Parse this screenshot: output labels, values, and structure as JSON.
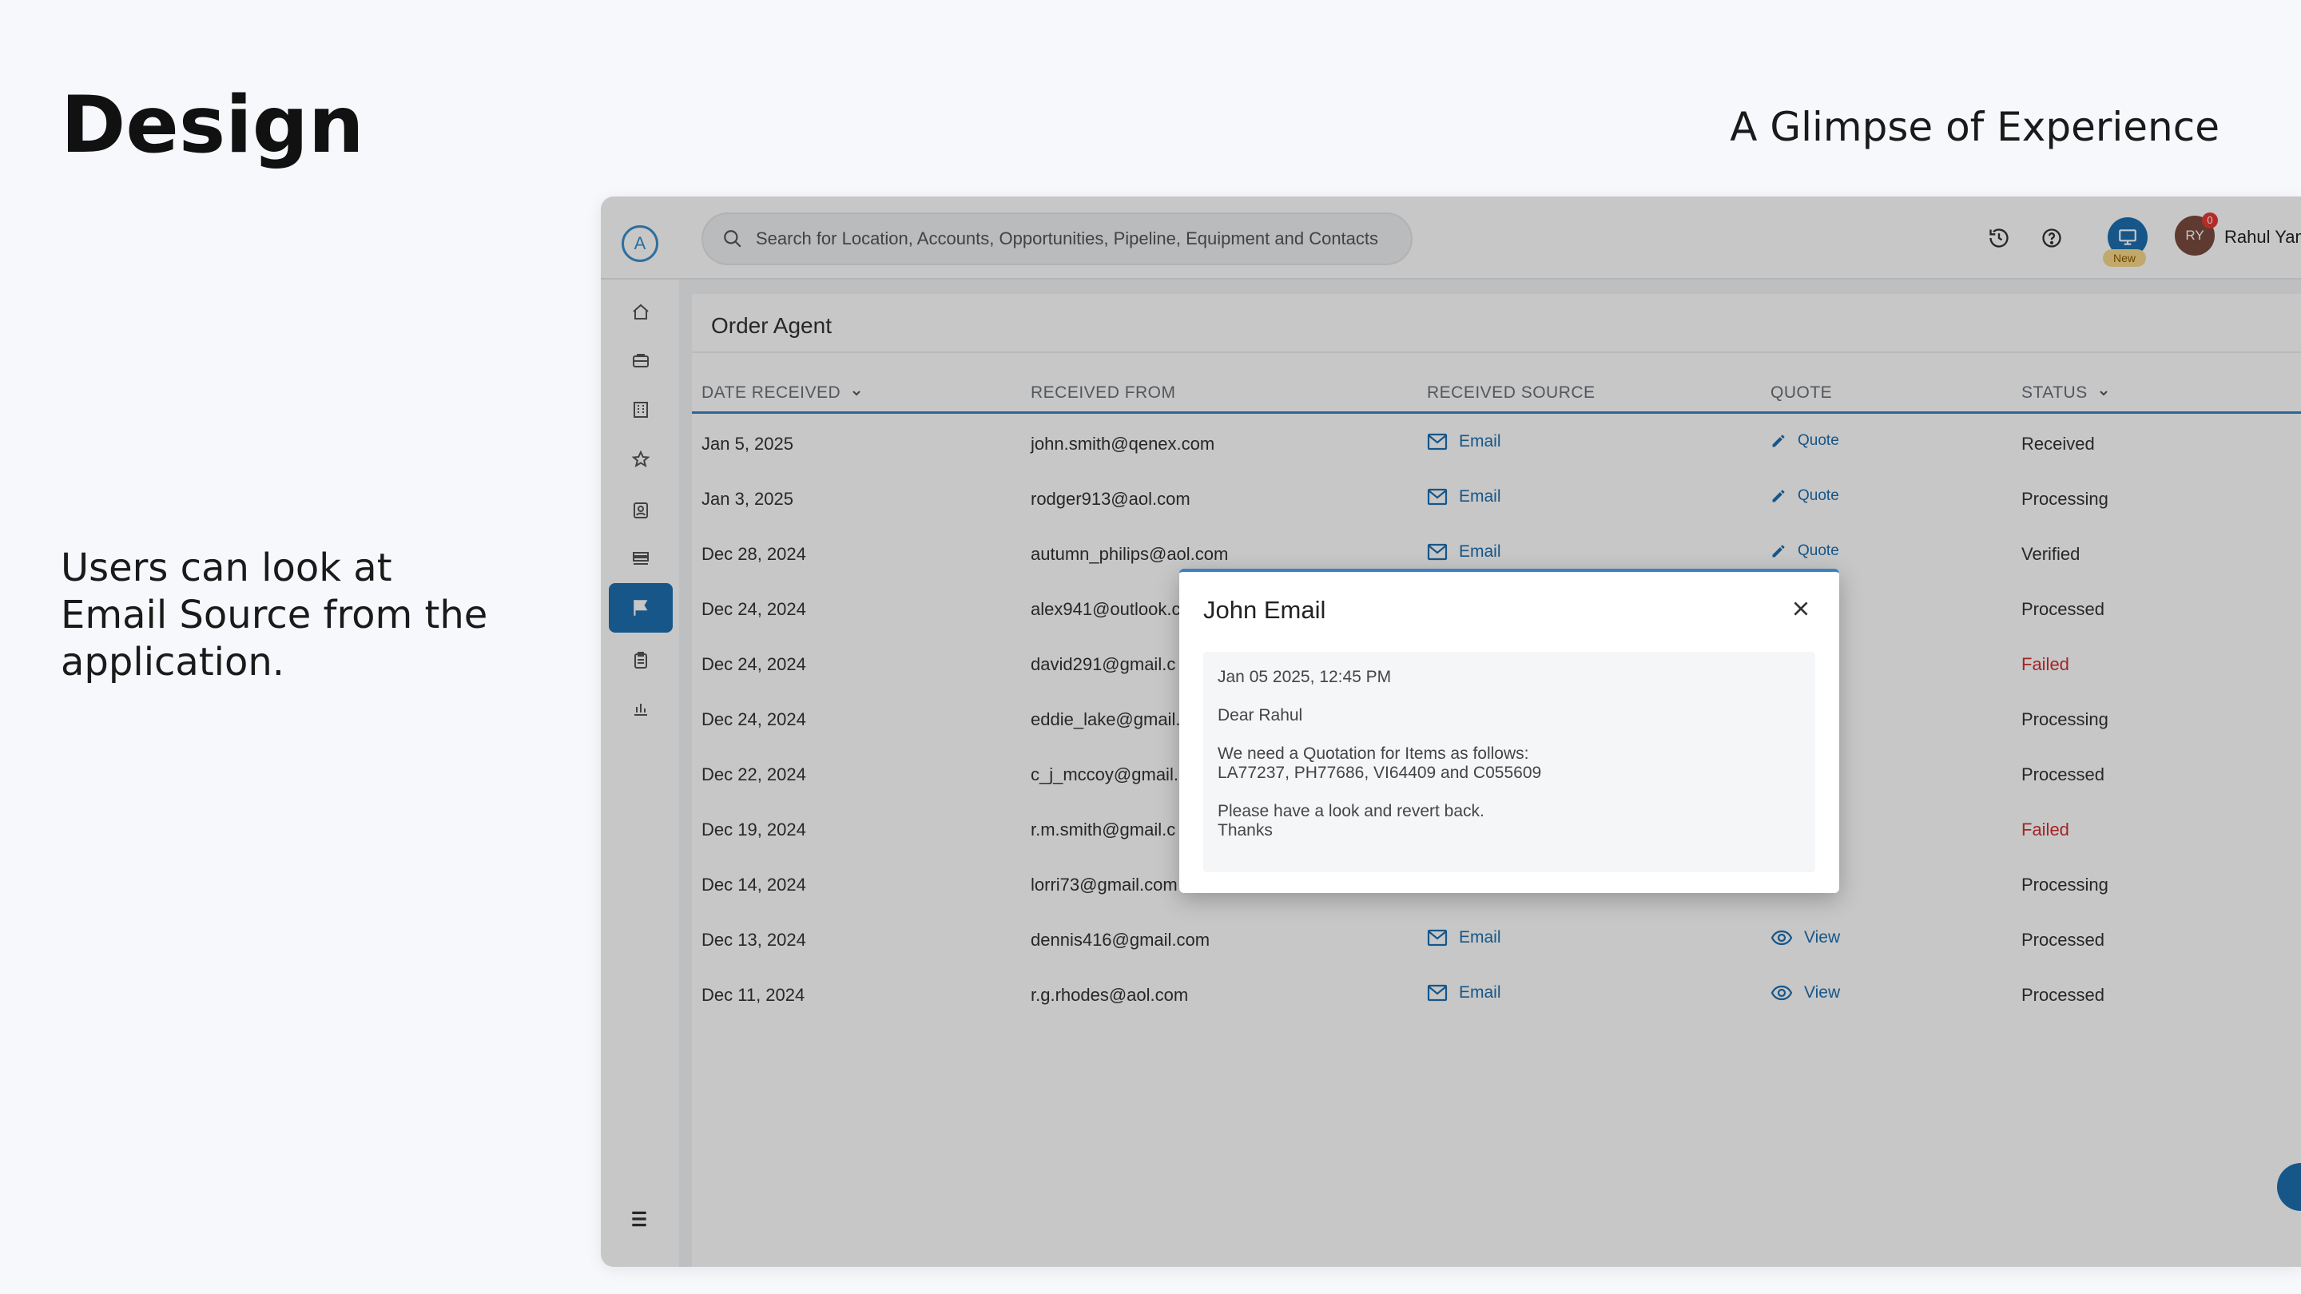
{
  "slide": {
    "title": "Design",
    "subtitle": "A Glimpse of Experience",
    "caption": "Users can look at Email Source from the application."
  },
  "app": {
    "logo_letter": "A",
    "search_placeholder": "Search for Location, Accounts, Opportunities, Pipeline, Equipment and Contacts",
    "new_badge": "New",
    "avatar_initials": "RY",
    "notification_count": "0",
    "user_name": "Rahul Yam",
    "page_title": "Order Agent",
    "columns": {
      "date_received": "DATE RECEIVED",
      "received_from": "RECEIVED FROM",
      "received_source": "RECEIVED SOURCE",
      "quote": "QUOTE",
      "status": "STATUS"
    },
    "rows": [
      {
        "date": "Jan 5, 2025",
        "from": "john.smith@qenex.com",
        "source": "Email",
        "quote": "Quote",
        "status": "Received"
      },
      {
        "date": "Jan 3, 2025",
        "from": "rodger913@aol.com",
        "source": "Email",
        "quote": "Quote",
        "status": "Processing"
      },
      {
        "date": "Dec 28, 2024",
        "from": "autumn_philips@aol.com",
        "source": "Email",
        "quote": "Quote",
        "status": "Verified"
      },
      {
        "date": "Dec 24, 2024",
        "from": "alex941@outlook.c",
        "source": "",
        "quote": "",
        "status": "Processed"
      },
      {
        "date": "Dec 24, 2024",
        "from": "david291@gmail.c",
        "source": "",
        "quote": "",
        "status": "Failed"
      },
      {
        "date": "Dec 24, 2024",
        "from": "eddie_lake@gmail.",
        "source": "",
        "quote": "",
        "status": "Processing"
      },
      {
        "date": "Dec 22, 2024",
        "from": "c_j_mccoy@gmail.",
        "source": "",
        "quote": "",
        "status": "Processed"
      },
      {
        "date": "Dec 19, 2024",
        "from": "r.m.smith@gmail.c",
        "source": "",
        "quote": "",
        "status": "Failed"
      },
      {
        "date": "Dec 14, 2024",
        "from": "lorri73@gmail.com",
        "source": "",
        "quote": "",
        "status": "Processing"
      },
      {
        "date": "Dec 13, 2024",
        "from": "dennis416@gmail.com",
        "source": "Email",
        "quote": "View",
        "status": "Processed"
      },
      {
        "date": "Dec 11, 2024",
        "from": "r.g.rhodes@aol.com",
        "source": "Email",
        "quote": "View",
        "status": "Processed"
      }
    ],
    "modal": {
      "title": "John Email",
      "date": "Jan 05 2025, 12:45 PM",
      "greeting": "Dear Rahul",
      "line1": "We need a Quotation for Items as follows:",
      "line2": "LA77237, PH77686, VI64409 and C055609",
      "line3": "Please have a look and revert back.",
      "line4": "Thanks"
    }
  },
  "colors": {
    "primary": "#1d6fb0",
    "failed": "#d32f2f",
    "header_underline": "#3b82c4"
  }
}
